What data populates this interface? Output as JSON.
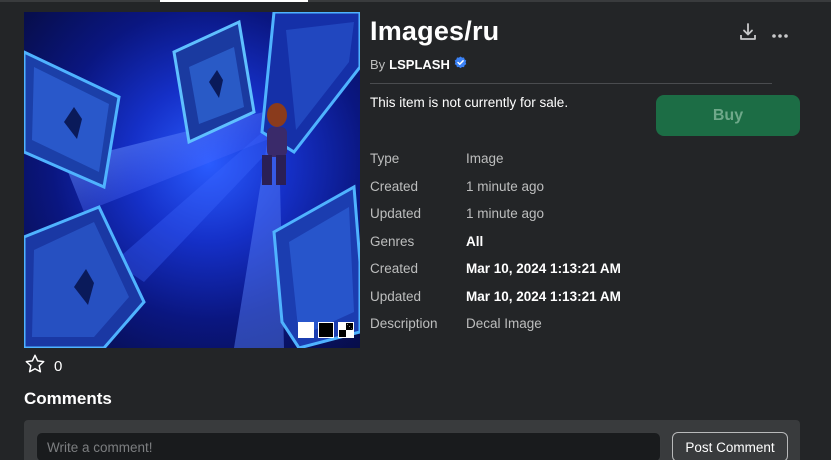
{
  "item": {
    "title": "Images/ru",
    "by_label": "By",
    "creator": "LSPLASH",
    "sale_status": "This item is not currently for sale.",
    "buy_label": "Buy"
  },
  "properties": [
    {
      "label": "Type",
      "value": "Image",
      "strong": false
    },
    {
      "label": "Created",
      "value": "1 minute ago",
      "strong": false
    },
    {
      "label": "Updated",
      "value": "1 minute ago",
      "strong": false
    },
    {
      "label": "Genres",
      "value": "All",
      "strong": true
    },
    {
      "label": "Created",
      "value": "Mar 10, 2024 1:13:21 AM",
      "strong": true
    },
    {
      "label": "Updated",
      "value": "Mar 10, 2024 1:13:21 AM",
      "strong": true
    },
    {
      "label": "Description",
      "value": "Decal Image",
      "strong": false
    }
  ],
  "favorites": {
    "count": "0"
  },
  "comments": {
    "title": "Comments",
    "placeholder": "Write a comment!",
    "post_label": "Post Comment"
  },
  "icons": {
    "download": "download-icon",
    "more": "more-options-icon",
    "verified": "verified-badge-icon",
    "favorite": "star-icon"
  },
  "colors": {
    "background": "#232527",
    "buy_button": "#1c6d45",
    "verified": "#3b82f6"
  }
}
